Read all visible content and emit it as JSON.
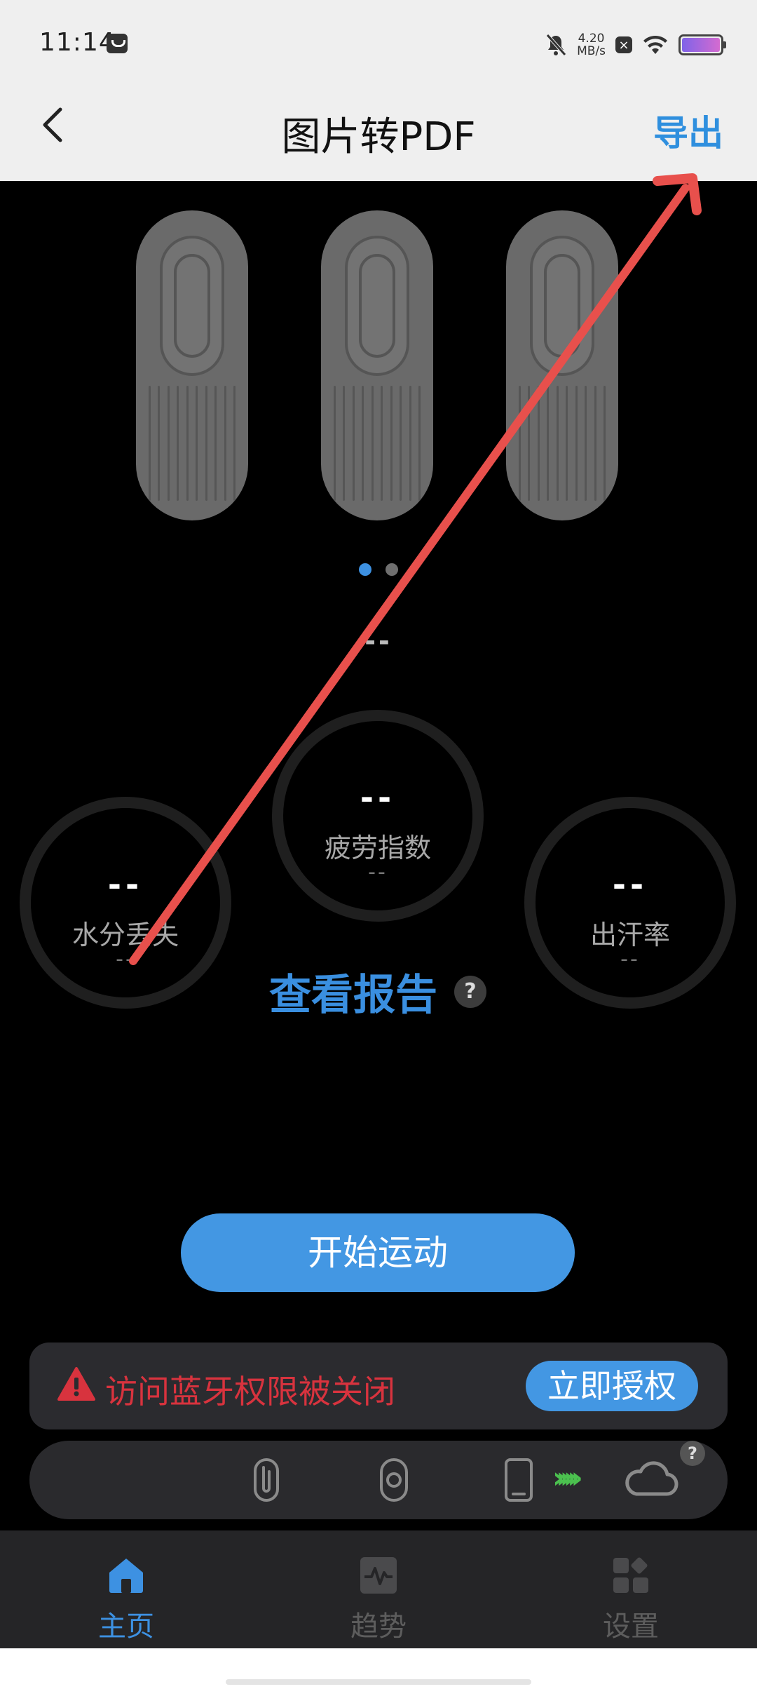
{
  "status_bar": {
    "time": "11:14",
    "net_speed_value": "4.20",
    "net_speed_unit": "MB/s",
    "icons": [
      "message-icon",
      "mute-bell-icon",
      "close-notification-icon",
      "wifi-icon",
      "battery-icon"
    ]
  },
  "header": {
    "title": "图片转PDF",
    "export_label": "导出",
    "back_icon": "chevron-left-icon"
  },
  "carousel": {
    "items": [
      "insole-left",
      "insole-middle",
      "insole-right"
    ],
    "page_count": 2,
    "active_page": 0
  },
  "top_value": "--",
  "metrics": {
    "water_loss": {
      "value": "--",
      "label": "水分丢失",
      "sub": "--"
    },
    "fatigue": {
      "value": "--",
      "label": "疲劳指数",
      "sub": "--"
    },
    "sweat_rate": {
      "value": "--",
      "label": "出汗率",
      "sub": "--"
    }
  },
  "report": {
    "label": "查看报告",
    "help": "?"
  },
  "start_button": "开始运动",
  "alert": {
    "message": "访问蓝牙权限被关闭",
    "action": "立即授权"
  },
  "device_bar": {
    "chevrons": "››››››",
    "help": "?",
    "icons": [
      "insole-icon",
      "sensor-icon",
      "phone-icon",
      "cloud-icon"
    ]
  },
  "bottom_nav": {
    "tabs": [
      {
        "label": "主页",
        "icon": "home-icon"
      },
      {
        "label": "趋势",
        "icon": "trend-icon"
      },
      {
        "label": "设置",
        "icon": "settings-icon"
      }
    ],
    "active": 0
  },
  "colors": {
    "accent_blue": "#3d91e2",
    "alert_red": "#d8333e",
    "annotation_arrow": "#e8504c"
  }
}
